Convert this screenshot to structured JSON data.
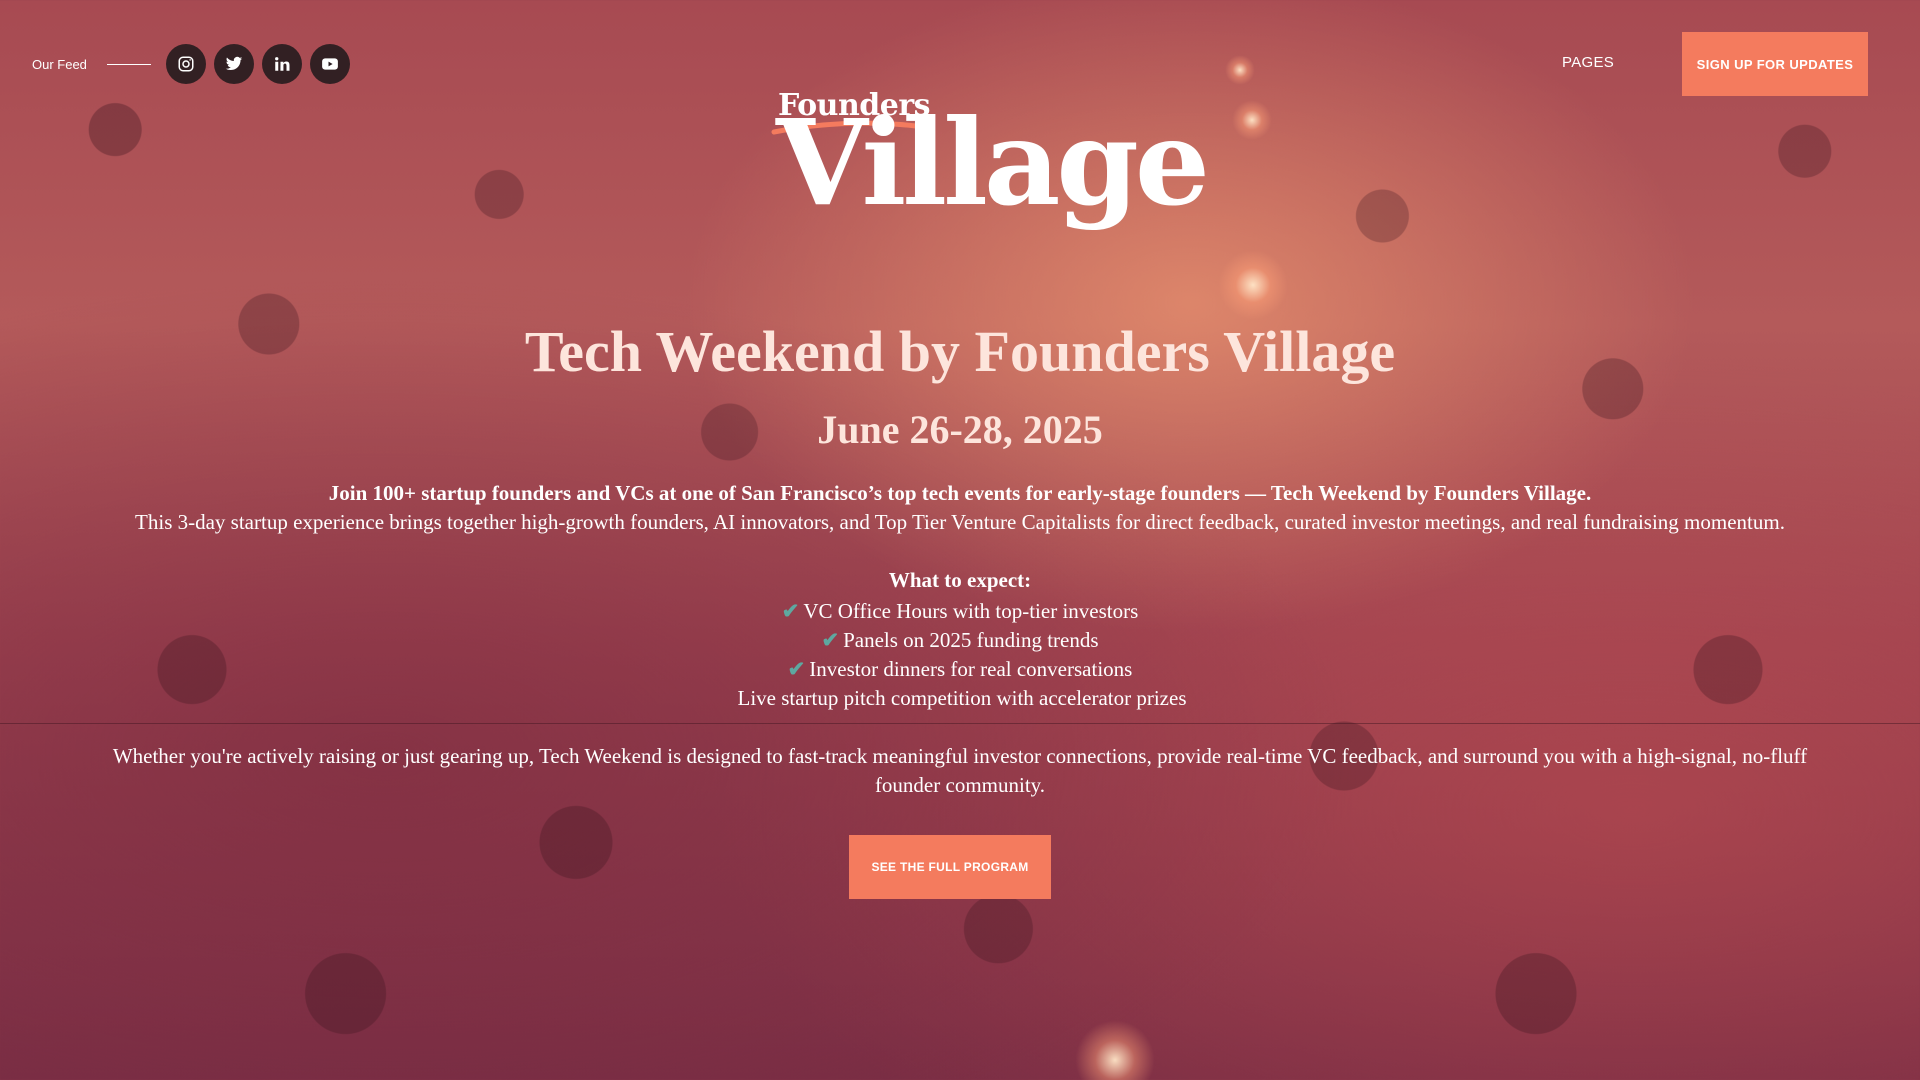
{
  "header": {
    "feed_label": "Our Feed",
    "socials": [
      {
        "icon": "instagram-icon"
      },
      {
        "icon": "twitter-icon"
      },
      {
        "icon": "linkedin-icon"
      },
      {
        "icon": "youtube-icon"
      }
    ],
    "pages_label": "PAGES",
    "signup_label": "SIGN UP FOR UPDATES"
  },
  "logo": {
    "top_text": "Founders",
    "main_text": "Village"
  },
  "hero": {
    "title": "Tech Weekend by Founders Village",
    "date": "June 26-28, 2025",
    "lead": "Join 100+ startup founders and VCs at one of San Francisco’s top tech events for early-stage founders — Tech Weekend by Founders Village.",
    "description": "This 3-day startup experience brings together high-growth founders, AI innovators, and Top Tier Venture Capitalists for direct feedback, curated investor meetings, and real fundraising momentum.",
    "expect_title": "What to expect:",
    "expect_items": [
      {
        "check": "✔",
        "text": "VC Office Hours with top-tier investors"
      },
      {
        "check": "✔",
        "text": "Panels on 2025 funding trends"
      },
      {
        "check": "✔",
        "text": "Investor dinners for real conversations"
      },
      {
        "check": "",
        "text": "Live startup pitch competition with accelerator prizes"
      }
    ],
    "closing": "Whether you're actively raising or just gearing up, Tech Weekend is designed to fast-track meaningful investor connections, provide real-time VC feedback, and surround you with a high-signal, no-fluff founder community.",
    "program_label": "SEE THE FULL PROGRAM"
  },
  "colors": {
    "accent": "#f47b5e",
    "check": "#5ea8a0",
    "title_text": "#fde5dc"
  }
}
